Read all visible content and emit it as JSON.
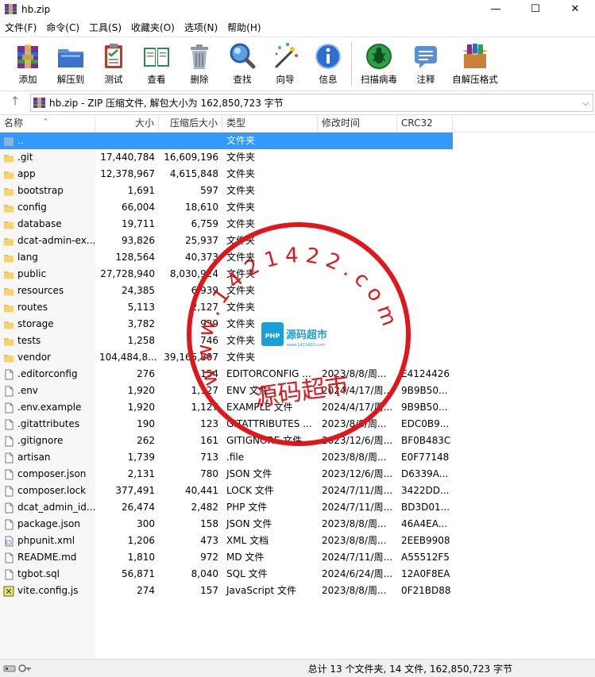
{
  "window": {
    "title": "hb.zip",
    "minimize": "—",
    "maximize": "☐",
    "close": "✕"
  },
  "menu": [
    "文件(F)",
    "命令(C)",
    "工具(S)",
    "收藏夹(O)",
    "选项(N)",
    "帮助(H)"
  ],
  "toolbar": [
    {
      "label": "添加",
      "icon": "add-archive-icon"
    },
    {
      "label": "解压到",
      "icon": "extract-to-icon"
    },
    {
      "label": "测试",
      "icon": "test-icon"
    },
    {
      "label": "查看",
      "icon": "view-book-icon"
    },
    {
      "label": "删除",
      "icon": "delete-trash-icon"
    },
    {
      "label": "查找",
      "icon": "find-magnifier-icon"
    },
    {
      "label": "向导",
      "icon": "wizard-wand-icon"
    },
    {
      "label": "信息",
      "icon": "info-icon"
    },
    {
      "label": "扫描病毒",
      "icon": "virus-scan-icon"
    },
    {
      "label": "注释",
      "icon": "comment-icon"
    },
    {
      "label": "自解压格式",
      "icon": "sfx-box-icon"
    }
  ],
  "address": {
    "up": "🡑",
    "text": "hb.zip - ZIP 压缩文件, 解包大小为 162,850,723 字节",
    "dropdown": "⌵"
  },
  "columns": [
    "名称",
    "大小",
    "压缩后大小",
    "类型",
    "修改时间",
    "CRC32"
  ],
  "sort_indicator": "^",
  "rows": [
    {
      "name": "..",
      "size": "",
      "packed": "",
      "type": "文件夹",
      "modified": "",
      "crc": "",
      "kind": "up",
      "selected": true
    },
    {
      "name": ".git",
      "size": "17,440,784",
      "packed": "16,609,196",
      "type": "文件夹",
      "modified": "",
      "crc": "",
      "kind": "folder"
    },
    {
      "name": "app",
      "size": "12,378,967",
      "packed": "4,615,848",
      "type": "文件夹",
      "modified": "",
      "crc": "",
      "kind": "folder"
    },
    {
      "name": "bootstrap",
      "size": "1,691",
      "packed": "597",
      "type": "文件夹",
      "modified": "",
      "crc": "",
      "kind": "folder"
    },
    {
      "name": "config",
      "size": "66,004",
      "packed": "18,610",
      "type": "文件夹",
      "modified": "",
      "crc": "",
      "kind": "folder"
    },
    {
      "name": "database",
      "size": "19,711",
      "packed": "6,759",
      "type": "文件夹",
      "modified": "",
      "crc": "",
      "kind": "folder"
    },
    {
      "name": "dcat-admin-ex...",
      "size": "93,826",
      "packed": "25,937",
      "type": "文件夹",
      "modified": "",
      "crc": "",
      "kind": "folder"
    },
    {
      "name": "lang",
      "size": "128,564",
      "packed": "40,373",
      "type": "文件夹",
      "modified": "",
      "crc": "",
      "kind": "folder"
    },
    {
      "name": "public",
      "size": "27,728,940",
      "packed": "8,030,924",
      "type": "文件夹",
      "modified": "",
      "crc": "",
      "kind": "folder"
    },
    {
      "name": "resources",
      "size": "24,385",
      "packed": "6,939",
      "type": "文件夹",
      "modified": "",
      "crc": "",
      "kind": "folder"
    },
    {
      "name": "routes",
      "size": "5,113",
      "packed": "2,127",
      "type": "文件夹",
      "modified": "",
      "crc": "",
      "kind": "folder"
    },
    {
      "name": "storage",
      "size": "3,782",
      "packed": "939",
      "type": "文件夹",
      "modified": "",
      "crc": "",
      "kind": "folder"
    },
    {
      "name": "tests",
      "size": "1,258",
      "packed": "746",
      "type": "文件夹",
      "modified": "",
      "crc": "",
      "kind": "folder"
    },
    {
      "name": "vendor",
      "size": "104,484,8...",
      "packed": "39,165,807",
      "type": "文件夹",
      "modified": "",
      "crc": "",
      "kind": "folder"
    },
    {
      "name": ".editorconfig",
      "size": "276",
      "packed": "154",
      "type": "EDITORCONFIG ...",
      "modified": "2023/8/8/周...",
      "crc": "E4124426",
      "kind": "file"
    },
    {
      "name": ".env",
      "size": "1,920",
      "packed": "1,127",
      "type": "ENV 文件",
      "modified": "2024/4/17/周...",
      "crc": "9B9B50...",
      "kind": "file"
    },
    {
      "name": ".env.example",
      "size": "1,920",
      "packed": "1,127",
      "type": "EXAMPLE 文件",
      "modified": "2024/4/17/周...",
      "crc": "9B9B50...",
      "kind": "file"
    },
    {
      "name": ".gitattributes",
      "size": "190",
      "packed": "123",
      "type": "GITATTRIBUTES ...",
      "modified": "2023/8/8/周...",
      "crc": "EDC0B9...",
      "kind": "file"
    },
    {
      "name": ".gitignore",
      "size": "262",
      "packed": "161",
      "type": "GITIGNORE 文件",
      "modified": "2023/12/6/周...",
      "crc": "BF0B483C",
      "kind": "file"
    },
    {
      "name": "artisan",
      "size": "1,739",
      "packed": "713",
      "type": ".file",
      "modified": "2023/8/8/周...",
      "crc": "E0F77148",
      "kind": "file"
    },
    {
      "name": "composer.json",
      "size": "2,131",
      "packed": "780",
      "type": "JSON 文件",
      "modified": "2023/12/6/周...",
      "crc": "D6339A...",
      "kind": "file"
    },
    {
      "name": "composer.lock",
      "size": "377,491",
      "packed": "40,441",
      "type": "LOCK 文件",
      "modified": "2024/7/11/周...",
      "crc": "3422DD...",
      "kind": "file"
    },
    {
      "name": "dcat_admin_id...",
      "size": "26,474",
      "packed": "2,482",
      "type": "PHP 文件",
      "modified": "2024/7/11/周...",
      "crc": "BD3D01...",
      "kind": "file"
    },
    {
      "name": "package.json",
      "size": "300",
      "packed": "158",
      "type": "JSON 文件",
      "modified": "2023/8/8/周...",
      "crc": "46A4EA...",
      "kind": "file"
    },
    {
      "name": "phpunit.xml",
      "size": "1,206",
      "packed": "473",
      "type": "XML 文档",
      "modified": "2023/8/8/周...",
      "crc": "2EEB9908",
      "kind": "xml"
    },
    {
      "name": "README.md",
      "size": "1,810",
      "packed": "972",
      "type": "MD 文件",
      "modified": "2024/7/11/周...",
      "crc": "A55512F5",
      "kind": "file"
    },
    {
      "name": "tgbot.sql",
      "size": "56,871",
      "packed": "8,040",
      "type": "SQL 文件",
      "modified": "2024/6/24/周...",
      "crc": "12A0F8EA",
      "kind": "file"
    },
    {
      "name": "vite.config.js",
      "size": "274",
      "packed": "157",
      "type": "JavaScript 文件",
      "modified": "2023/8/8/周...",
      "crc": "0F21BD88",
      "kind": "js"
    }
  ],
  "watermark": {
    "ring_text": "www.1421422.com",
    "center_text": "源码超市",
    "logo_text": "源码超市",
    "logo_sub": "www.1421422.com",
    "logo_badge": "PHP",
    "color": "#e0161b"
  },
  "status": {
    "text": "总计 13 个文件夹, 14 文件, 162,850,723 字节"
  },
  "colors": {
    "selection": "#3399ff",
    "folder": "#f2c34b",
    "stamp": "#e0161b"
  }
}
